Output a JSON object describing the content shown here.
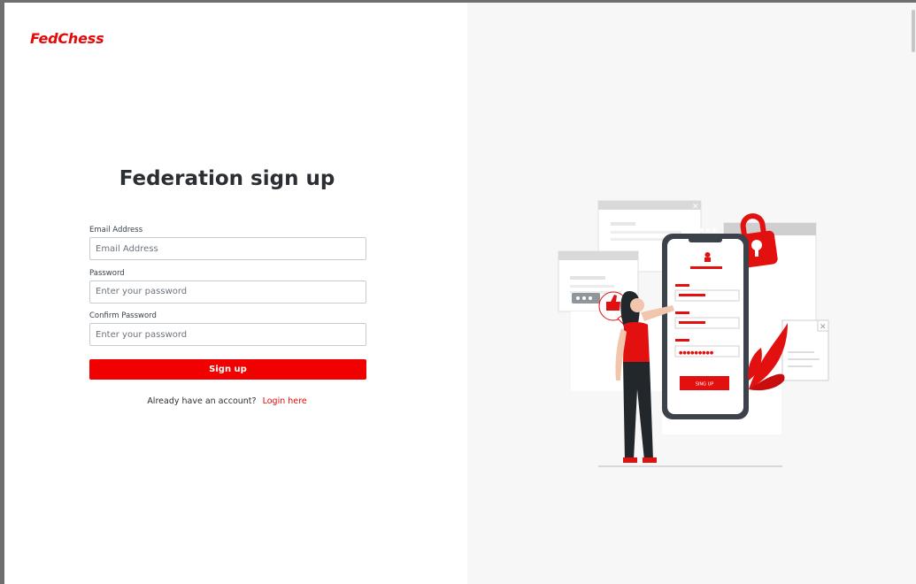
{
  "brand": {
    "logo_text": "FedChess",
    "accent_color": "#f10000"
  },
  "page": {
    "title": "Federation sign up"
  },
  "form": {
    "email": {
      "label": "Email Address",
      "placeholder": "Email Address"
    },
    "password": {
      "label": "Password",
      "placeholder": "Enter your password"
    },
    "confirm_password": {
      "label": "Confirm Password",
      "placeholder": "Enter your password"
    },
    "submit_label": "Sign up"
  },
  "footer": {
    "prompt": "Already have an account?",
    "login_link": "Login here"
  },
  "illustration": {
    "button_text": "SING UP",
    "password_dots": "●●●●●●●●●"
  }
}
